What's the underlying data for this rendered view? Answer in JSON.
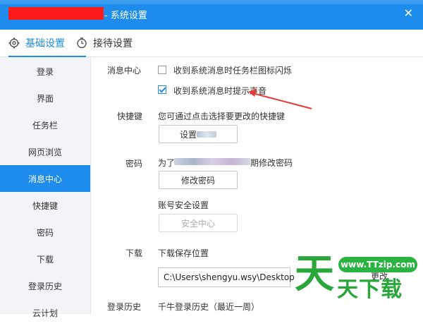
{
  "window": {
    "title": "- 系统设置",
    "close_glyph": "✕"
  },
  "tabs": [
    {
      "label": "基础设置",
      "icon": "gear-icon"
    },
    {
      "label": "接待设置",
      "icon": "clock-icon"
    }
  ],
  "sidebar": {
    "items": [
      {
        "label": "登录"
      },
      {
        "label": "界面"
      },
      {
        "label": "任务栏"
      },
      {
        "label": "网页浏览"
      },
      {
        "label": "消息中心",
        "active": true
      },
      {
        "label": "快捷键"
      },
      {
        "label": "密码"
      },
      {
        "label": "下载"
      },
      {
        "label": "登录历史"
      },
      {
        "label": "云计划"
      }
    ]
  },
  "message_center": {
    "section_label": "消息中心",
    "option_taskbar_flash": "收到系统消息时任务栏图标闪烁",
    "option_taskbar_flash_checked": false,
    "option_sound": "收到系统消息时提示声音",
    "option_sound_checked": true
  },
  "hotkey": {
    "section_label": "快捷键",
    "hint": "您可通过点击选择要更改的快捷键",
    "button": "设置"
  },
  "password": {
    "section_label": "密码",
    "text_prefix": "为了",
    "text_suffix": "期修改密码",
    "change_button": "修改密码",
    "account_security_label": "账号安全设置",
    "security_center_button": "安全中心"
  },
  "download": {
    "section_label": "下载",
    "save_location_label": "下载保存位置",
    "path_value": "C:\\Users\\shengyu.wsy\\Desktop",
    "change_button": "更改"
  },
  "login_history": {
    "section_label": "登录历史",
    "text": "千牛登录历史（最近一周）"
  },
  "watermark": {
    "url": "www.TTzip.com",
    "big_char": "天",
    "small_text": "天下载"
  },
  "colors": {
    "accent": "#1e8cec",
    "redaction": "#ff1a1a",
    "annotation_arrow": "#e53935",
    "watermark_green": "#29a73a"
  }
}
